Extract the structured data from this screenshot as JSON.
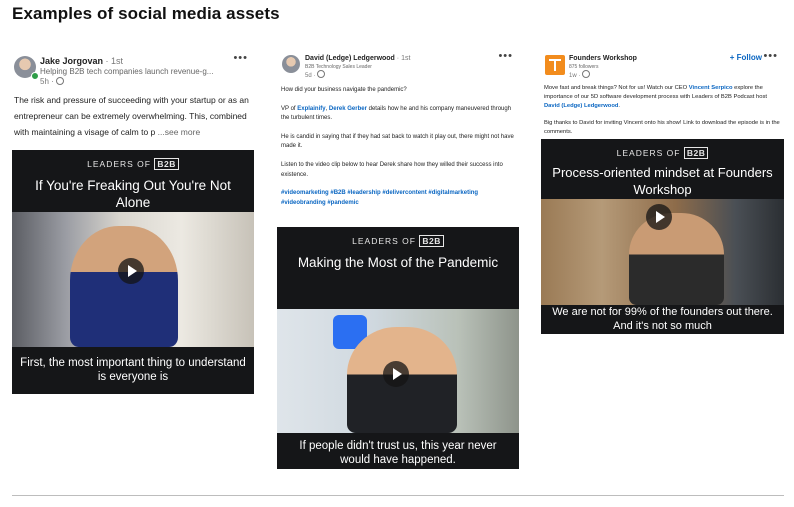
{
  "page": {
    "title": "Examples of social media assets"
  },
  "posts": [
    {
      "author": "Jake Jorgovan",
      "degree": "· 1st",
      "tagline": "Helping B2B tech companies launch revenue-g...",
      "meta": "5h ·",
      "more": "•••",
      "text": "The risk and pressure of succeeding with your startup or as an entrepreneur can be extremely overwhelming. This, combined with maintaining a visage of calm to p",
      "see_more": "...see more",
      "video": {
        "brand_prefix": "LEADERS OF",
        "brand_box": "B2B",
        "title": "If You're Freaking Out You're Not Alone",
        "caption": "First, the most important thing to understand is everyone is"
      }
    },
    {
      "author": "David (Ledge) Ledgerwood",
      "degree": "· 1st",
      "tagline": "B2B Technology Sales Leader",
      "meta": "5d ·",
      "more": "•••",
      "p1": "How did your business navigate the pandemic?",
      "p2_a": "VP of ",
      "p2_link1": "Explainify",
      "p2_b": ", ",
      "p2_link2": "Derek Gerber",
      "p2_c": " details how he and his company maneuvered through the turbulent times.",
      "p3": "He is candid in saying that if they had sat back to watch it play out, there might not have made it.",
      "p4": "Listen to the video clip below to hear Derek share how they willed their success into existence.",
      "hashtags": "#videomarketing #B2B #leadership #delivercontent #digitalmarketing #videobranding #pandemic",
      "video": {
        "brand_prefix": "LEADERS OF",
        "brand_box": "B2B",
        "title": "Making the Most of the Pandemic",
        "caption": "If people didn't trust us, this year never would have happened."
      }
    },
    {
      "author": "Founders Workshop",
      "followers": "875 followers",
      "meta": "1w ·",
      "follow": "+ Follow",
      "more": "•••",
      "p1_a": "Move fast and break things? Not for us! Watch our CEO ",
      "p1_link1": "Vincent Serpico",
      "p1_b": " explore the importance of our 5D software development process with Leaders of B2B Podcast host ",
      "p1_link2": "David (Ledge) Ledgerwood",
      "p1_c": ".",
      "p2": "Big thanks to David for inviting Vincent onto his show! Link to download the episode is in the comments.",
      "video": {
        "brand_prefix": "LEADERS OF",
        "brand_box": "B2B",
        "title": "Process-oriented mindset at Founders Workshop",
        "caption": "We are not for 99% of the founders out there. And it's not so much"
      }
    }
  ]
}
